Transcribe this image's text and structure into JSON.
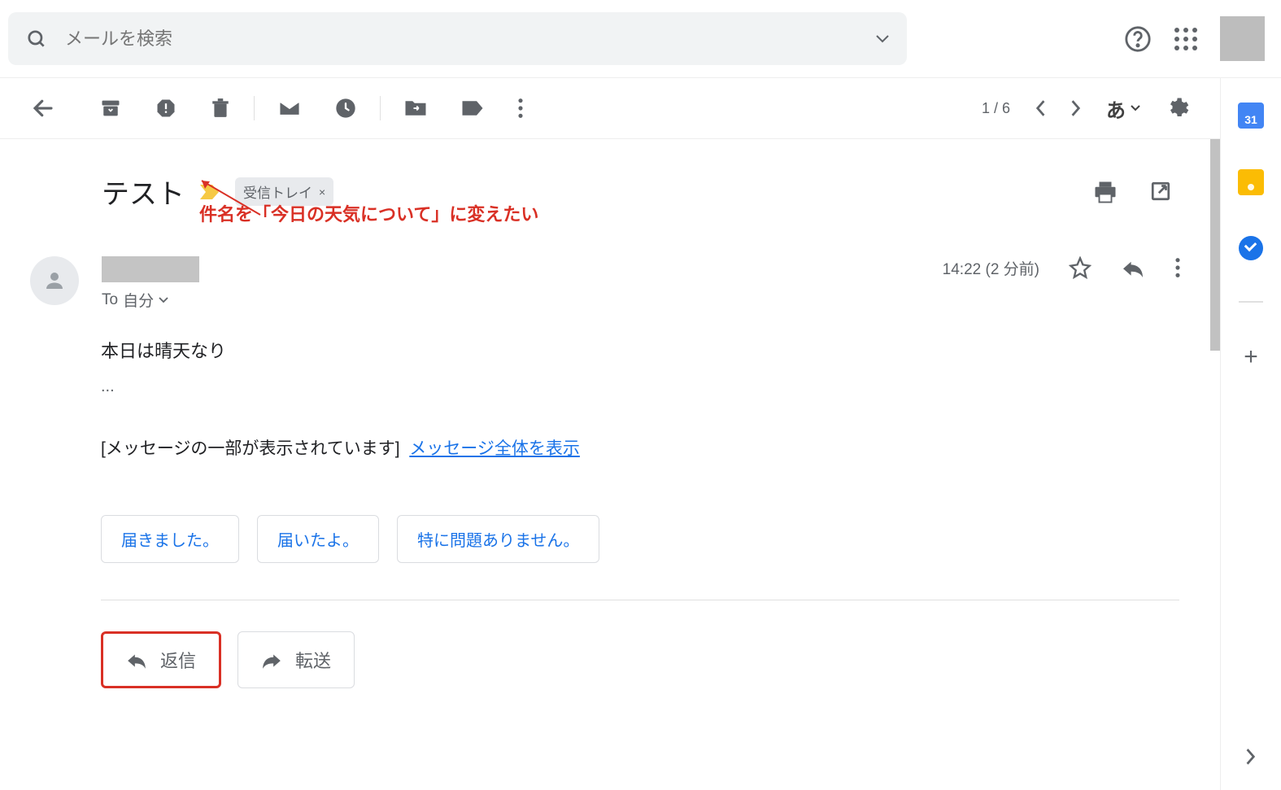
{
  "search": {
    "placeholder": "メールを検索"
  },
  "toolbar": {
    "count": "1 / 6",
    "lang": "あ"
  },
  "email": {
    "subject": "テスト",
    "label": "受信トレイ",
    "to_prefix": "To",
    "to_value": "自分",
    "time": "14:22 (2 分前)",
    "body": "本日は晴天なり",
    "ellipsis": "...",
    "clipped_notice": "[メッセージの一部が表示されています]",
    "clipped_link": "メッセージ全体を表示",
    "smart_replies": [
      "届きました。",
      "届いたよ。",
      "特に問題ありません。"
    ],
    "reply_label": "返信",
    "forward_label": "転送"
  },
  "annotation": {
    "text": "件名を「今日の天気について」に変えたい"
  },
  "sidepanel": {
    "calendar_day": "31"
  }
}
